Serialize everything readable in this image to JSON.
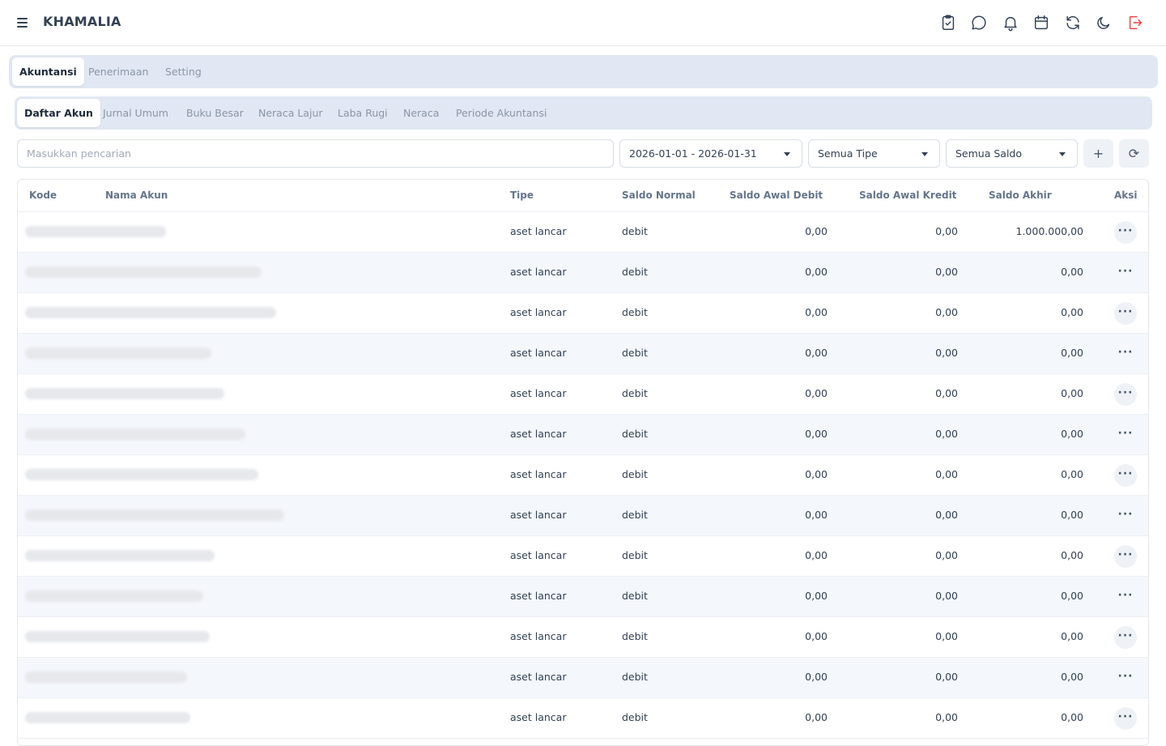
{
  "header": {
    "brand": "KHAMALIA"
  },
  "tabs_main": [
    "Akuntansi",
    "Penerimaan",
    "Setting"
  ],
  "tabs_sub": [
    "Daftar Akun",
    "Jurnal Umum",
    "Buku Besar",
    "Neraca Lajur",
    "Laba Rugi",
    "Neraca",
    "Periode Akuntansi"
  ],
  "filters": {
    "search_placeholder": "Masukkan pencarian",
    "date_range": "2026-01-01 - 2026-01-31",
    "type": "Semua Tipe",
    "balance": "Semua Saldo",
    "add_label": "+",
    "refresh_label": "⟳"
  },
  "table": {
    "columns": [
      "Kode",
      "Nama Akun",
      "Tipe",
      "Saldo Normal",
      "Saldo Awal Debit",
      "Saldo Awal Kredit",
      "Saldo Akhir",
      "Aksi"
    ],
    "action_label": "···",
    "rows": [
      {
        "tipe": "aset lancar",
        "saldo_normal": "debit",
        "awal_debit": "0,00",
        "awal_kredit": "0,00",
        "akhir": "1.000.000,00"
      },
      {
        "tipe": "aset lancar",
        "saldo_normal": "debit",
        "awal_debit": "0,00",
        "awal_kredit": "0,00",
        "akhir": "0,00"
      },
      {
        "tipe": "aset lancar",
        "saldo_normal": "debit",
        "awal_debit": "0,00",
        "awal_kredit": "0,00",
        "akhir": "0,00"
      },
      {
        "tipe": "aset lancar",
        "saldo_normal": "debit",
        "awal_debit": "0,00",
        "awal_kredit": "0,00",
        "akhir": "0,00"
      },
      {
        "tipe": "aset lancar",
        "saldo_normal": "debit",
        "awal_debit": "0,00",
        "awal_kredit": "0,00",
        "akhir": "0,00"
      },
      {
        "tipe": "aset lancar",
        "saldo_normal": "debit",
        "awal_debit": "0,00",
        "awal_kredit": "0,00",
        "akhir": "0,00"
      },
      {
        "tipe": "aset lancar",
        "saldo_normal": "debit",
        "awal_debit": "0,00",
        "awal_kredit": "0,00",
        "akhir": "0,00"
      },
      {
        "tipe": "aset lancar",
        "saldo_normal": "debit",
        "awal_debit": "0,00",
        "awal_kredit": "0,00",
        "akhir": "0,00"
      },
      {
        "tipe": "aset lancar",
        "saldo_normal": "debit",
        "awal_debit": "0,00",
        "awal_kredit": "0,00",
        "akhir": "0,00"
      },
      {
        "tipe": "aset lancar",
        "saldo_normal": "debit",
        "awal_debit": "0,00",
        "awal_kredit": "0,00",
        "akhir": "0,00"
      },
      {
        "tipe": "aset lancar",
        "saldo_normal": "debit",
        "awal_debit": "0,00",
        "awal_kredit": "0,00",
        "akhir": "0,00"
      },
      {
        "tipe": "aset lancar",
        "saldo_normal": "debit",
        "awal_debit": "0,00",
        "awal_kredit": "0,00",
        "akhir": "0,00"
      },
      {
        "tipe": "aset lancar",
        "saldo_normal": "debit",
        "awal_debit": "0,00",
        "awal_kredit": "0,00",
        "akhir": "0,00"
      }
    ]
  },
  "icons": [
    "menu-icon",
    "clipboard-check-icon",
    "chat-icon",
    "bell-icon",
    "calendar-icon",
    "sync-icon",
    "moon-icon",
    "logout-icon"
  ],
  "colors": {
    "tab_bg": "#e1e8f3",
    "row_alt": "#f4f7fc",
    "logout": "#ef4444"
  }
}
